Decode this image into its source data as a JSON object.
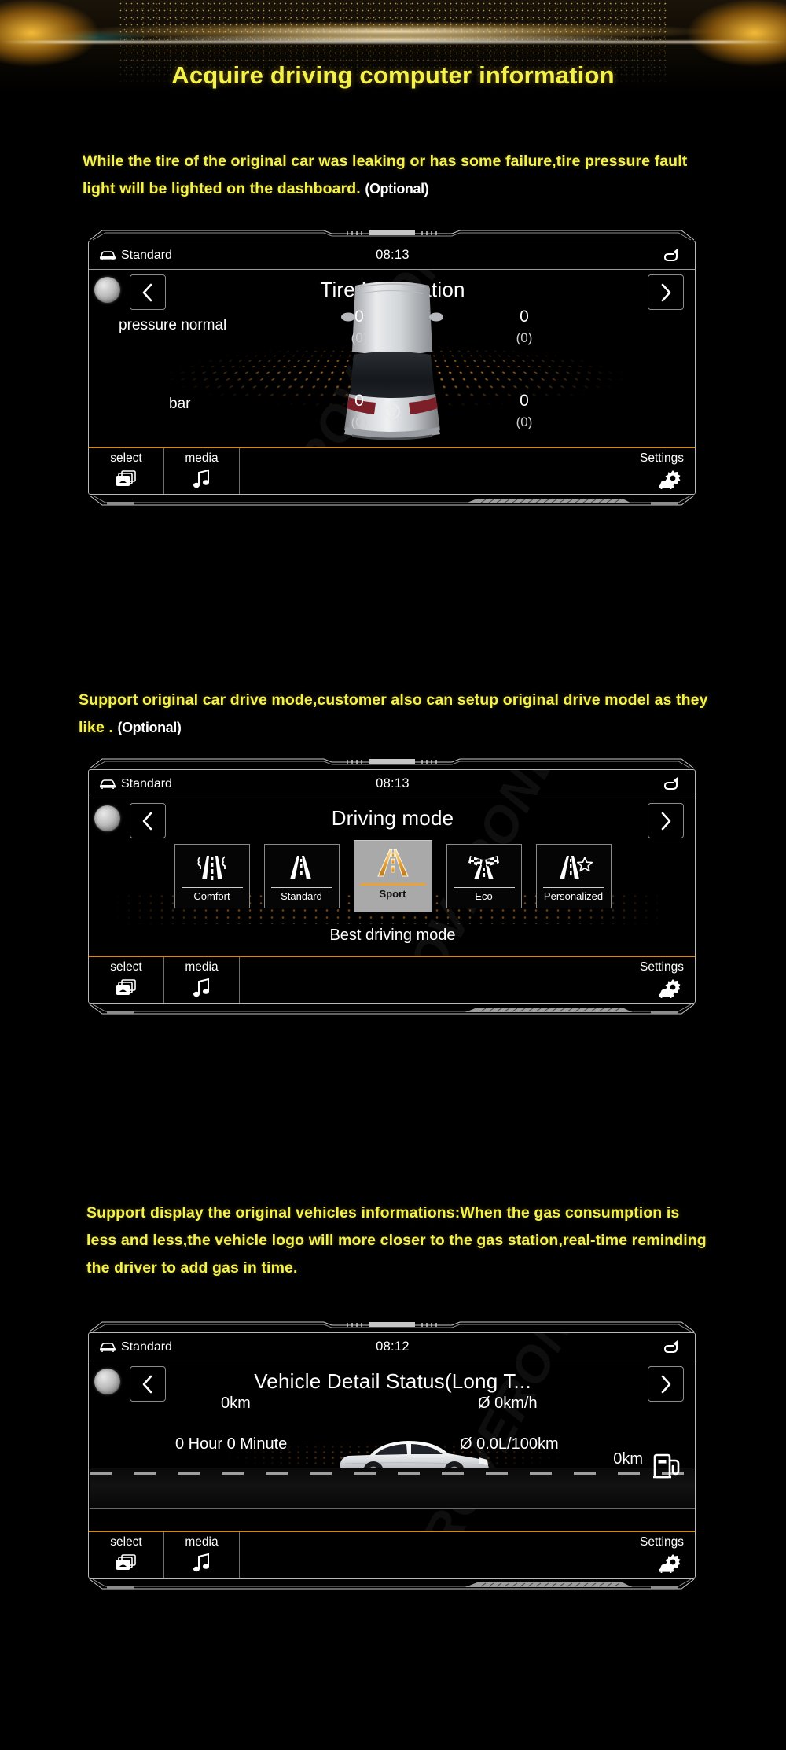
{
  "page": {
    "title": "Acquire driving computer information",
    "watermark": "ROVERONE",
    "accent_yellow": "#f4f24a",
    "accent_orange": "#d08a1e"
  },
  "captions": {
    "one": {
      "text": "While the tire of the original car was leaking or has some failure,tire pressure fault light will be lighted on the dashboard. ",
      "optional": "(Optional)"
    },
    "two": {
      "text": "Support original car drive mode,customer also can setup original drive model as they like . ",
      "optional": "(Optional)"
    },
    "three": {
      "text": "Support display the original vehicles informations:When the gas consumption is less and less,the vehicle logo will more closer to the gas station,real-time reminding the driver to add gas in time.",
      "optional": ""
    }
  },
  "shortcut_bar": {
    "select_label": "select",
    "media_label": "media",
    "settings_label": "Settings"
  },
  "panel_tire": {
    "status": {
      "profile": "Standard",
      "clock": "08:13"
    },
    "title": "Tire Information",
    "status_label": "pressure normal",
    "unit_label": "bar",
    "wheels": [
      {
        "position": "front-left",
        "value": "0",
        "sub": "(0)"
      },
      {
        "position": "front-right",
        "value": "0",
        "sub": "(0)"
      },
      {
        "position": "rear-left",
        "value": "0",
        "sub": "(0)"
      },
      {
        "position": "rear-right",
        "value": "0",
        "sub": "(0)"
      }
    ]
  },
  "panel_drive_mode": {
    "status": {
      "profile": "Standard",
      "clock": "08:13"
    },
    "title": "Driving mode",
    "caption": "Best driving mode",
    "modes": [
      {
        "name": "Comfort",
        "icon": "road-trees-icon",
        "selected": false
      },
      {
        "name": "Standard",
        "icon": "road-plain-icon",
        "selected": false
      },
      {
        "name": "Sport",
        "icon": "road-sport-icon",
        "selected": true
      },
      {
        "name": "Eco",
        "icon": "road-checkered-flag-icon",
        "selected": false
      },
      {
        "name": "Personalized",
        "icon": "road-star-icon",
        "selected": false
      }
    ]
  },
  "panel_vehicle_status": {
    "status": {
      "profile": "Standard",
      "clock": "08:12"
    },
    "title": "Vehicle Detail Status(Long T...",
    "metrics": [
      {
        "label": "distance",
        "value": "0km"
      },
      {
        "label": "average-speed",
        "value": "Ø 0km/h"
      },
      {
        "label": "drive-time",
        "value": "0 Hour 0 Minute"
      },
      {
        "label": "average-consumption",
        "value": "Ø 0.0L/100km"
      }
    ],
    "range_value": "0km",
    "fuel_icon": "fuel-pump-icon"
  }
}
